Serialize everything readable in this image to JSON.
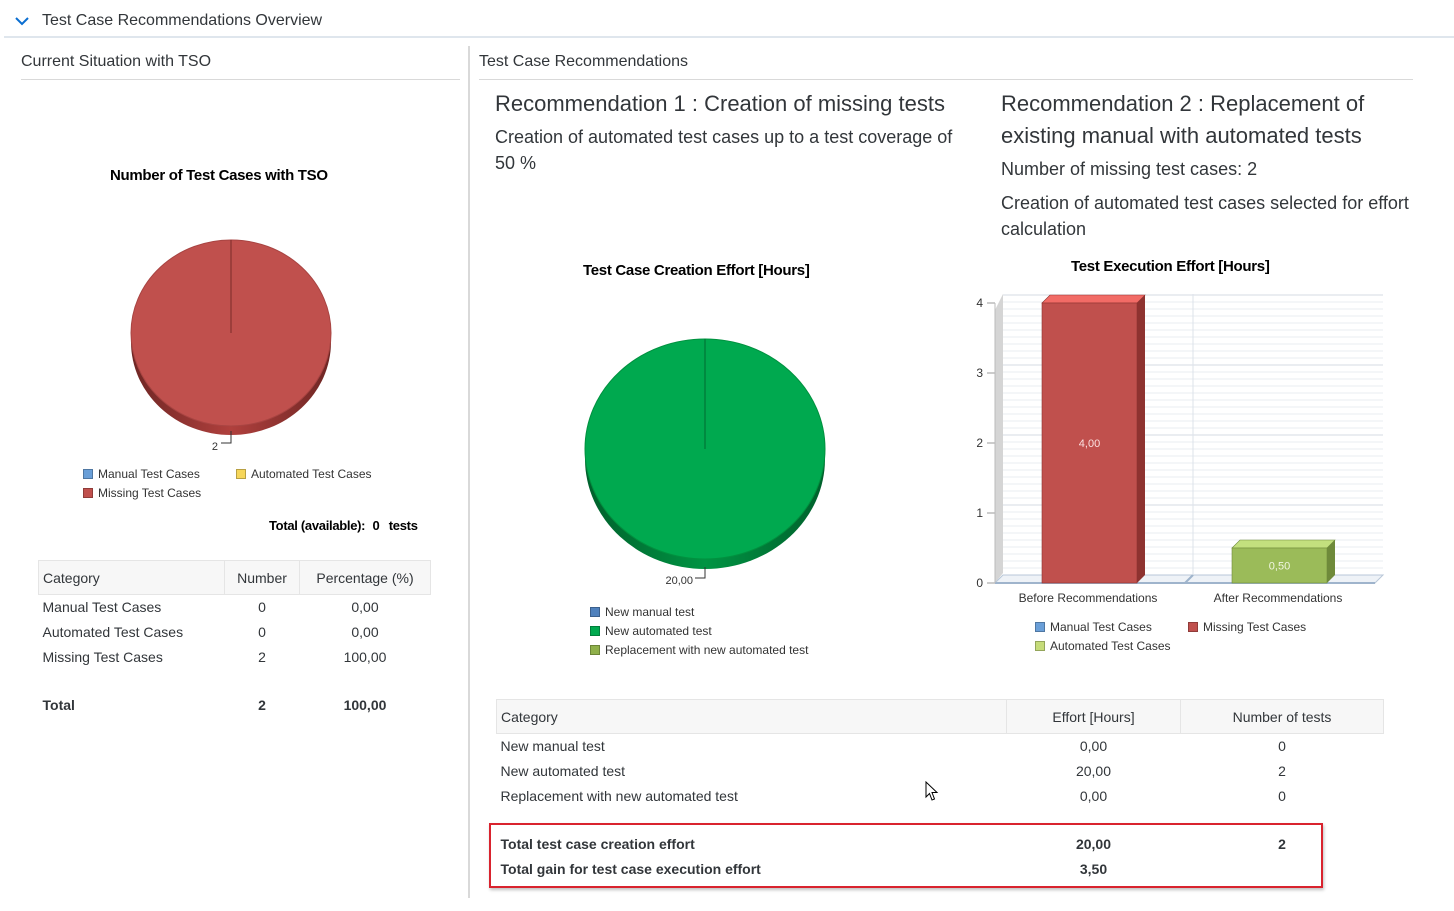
{
  "header": {
    "title": "Test Case Recommendations Overview"
  },
  "left": {
    "section_title": "Current Situation with TSO",
    "chart_title": "Number of Test Cases with TSO",
    "pie_label": "2",
    "legend": [
      {
        "label": "Manual Test Cases",
        "color": "#6a9fd8"
      },
      {
        "label": "Automated Test Cases",
        "color": "#f6d65a"
      },
      {
        "label": "Missing Test Cases",
        "color": "#c0504d"
      }
    ],
    "total_label": "Total (available):",
    "total_value": "0",
    "total_unit": "tests",
    "table": {
      "headers": [
        "Category",
        "Number",
        "Percentage (%)"
      ],
      "rows": [
        [
          "Manual Test Cases",
          "0",
          "0,00"
        ],
        [
          "Automated Test Cases",
          "0",
          "0,00"
        ],
        [
          "Missing Test Cases",
          "2",
          "100,00"
        ]
      ],
      "total": [
        "Total",
        "2",
        "100,00"
      ]
    }
  },
  "right": {
    "section_title": "Test Case Recommendations",
    "rec1": {
      "title": "Recommendation 1 : Creation of missing tests",
      "desc": "Creation of automated test cases up to a test coverage of 50 %",
      "chart_title": "Test Case Creation Effort [Hours]",
      "pie_label": "20,00",
      "legend": [
        {
          "label": "New manual test",
          "color": "#4f81bd"
        },
        {
          "label": "New automated test",
          "color": "#00a94f"
        },
        {
          "label": "Replacement with new automated test",
          "color": "#8fb04a"
        }
      ]
    },
    "rec2": {
      "title": "Recommendation 2 : Replacement of existing manual with automated tests",
      "missing": "Number of missing test cases: 2",
      "desc": "Creation of automated test cases selected for effort calculation",
      "chart_title": "Test Execution Effort [Hours]",
      "legend": [
        {
          "label": "Manual Test Cases",
          "color": "#6a9fd8"
        },
        {
          "label": "Missing Test Cases",
          "color": "#c0504d"
        },
        {
          "label": "Automated Test Cases",
          "color": "#c6dc7a"
        }
      ]
    },
    "table": {
      "headers": [
        "Category",
        "Effort [Hours]",
        "Number of tests"
      ],
      "rows": [
        [
          "New manual test",
          "0,00",
          "0"
        ],
        [
          "New automated test",
          "20,00",
          "2"
        ],
        [
          "Replacement with new automated test",
          "0,00",
          "0"
        ]
      ],
      "totals": [
        [
          "Total test case creation effort",
          "20,00",
          "2"
        ],
        [
          "Total gain for test case execution effort",
          "3,50",
          ""
        ]
      ]
    }
  },
  "chart_data": [
    {
      "type": "pie",
      "title": "Number of Test Cases with TSO",
      "slices": [
        {
          "name": "Manual Test Cases",
          "value": 0
        },
        {
          "name": "Automated Test Cases",
          "value": 0
        },
        {
          "name": "Missing Test Cases",
          "value": 2
        }
      ]
    },
    {
      "type": "pie",
      "title": "Test Case Creation Effort [Hours]",
      "slices": [
        {
          "name": "New manual test",
          "value": 0
        },
        {
          "name": "New automated test",
          "value": 20
        },
        {
          "name": "Replacement with new automated test",
          "value": 0
        }
      ]
    },
    {
      "type": "bar",
      "title": "Test Execution Effort [Hours]",
      "categories": [
        "Before Recommendations",
        "After Recommendations"
      ],
      "series": [
        {
          "name": "Missing Test Cases",
          "values": [
            4.0,
            0
          ]
        },
        {
          "name": "Automated Test Cases",
          "values": [
            0,
            0.5
          ]
        }
      ],
      "data_labels": [
        "4,00",
        "0,50"
      ],
      "y_ticks": [
        "0",
        "1",
        "2",
        "3",
        "4"
      ],
      "ylim": [
        0,
        4
      ],
      "grid": true
    }
  ]
}
